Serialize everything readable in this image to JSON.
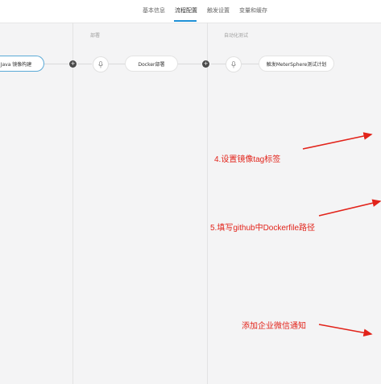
{
  "tabs": [
    {
      "label": "基本信息",
      "active": false
    },
    {
      "label": "流程配置",
      "active": true
    },
    {
      "label": "触发设置",
      "active": false
    },
    {
      "label": "变量和缓存",
      "active": false
    }
  ],
  "stages": {
    "deploy_label": "部署",
    "autotest_label": "自动化测试"
  },
  "tasks": {
    "build": "Java 镜像构建",
    "docker": "Docker部署",
    "metersphere": "触发MeterSphere测试计划"
  },
  "annotations": {
    "tag": "4.设置镜像tag标签",
    "dockerfile": "5.填写github中Dockerfile路径",
    "wechat": "添加企业微信通知"
  },
  "colors": {
    "accent": "#1e90d6",
    "annotation": "#e2231a"
  }
}
